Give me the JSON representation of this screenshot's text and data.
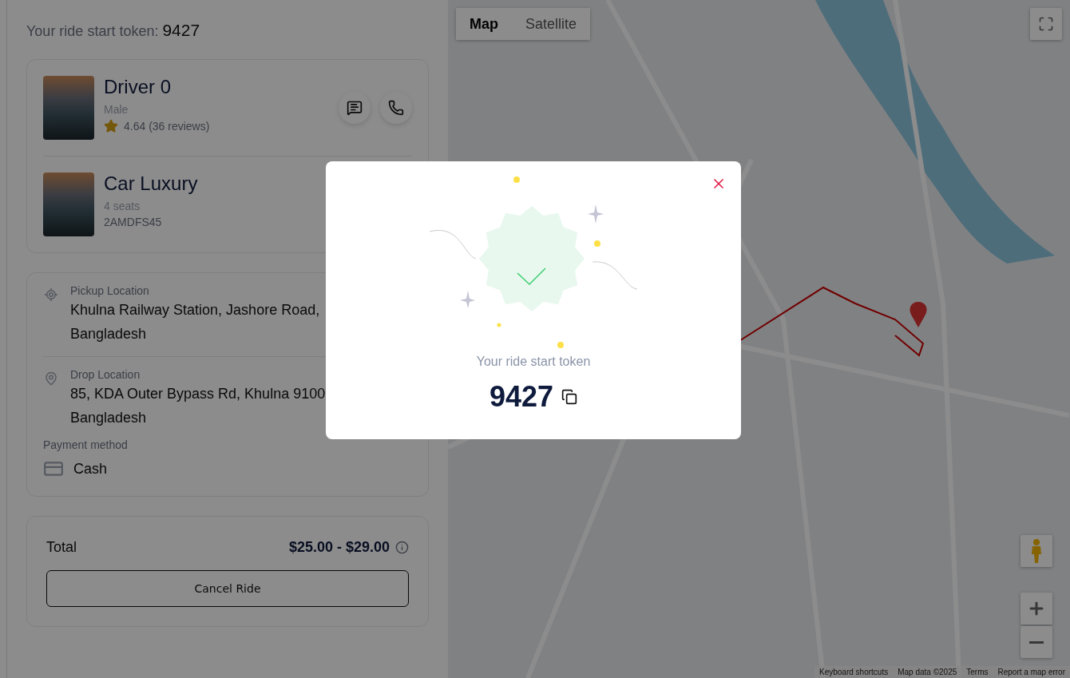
{
  "header": {
    "label": "Your ride start token:",
    "token": "9427"
  },
  "driver": {
    "name": "Driver 0",
    "gender": "Male",
    "rating": "4.64 (36 reviews)"
  },
  "vehicle": {
    "name": "Car Luxury",
    "seats": "4 seats",
    "plate": "2AMDFS45"
  },
  "route": [
    {
      "kind": "pickup",
      "label": "Pickup Location",
      "lines": [
        "Khulna Railway Station, Jashore Road,",
        "Bangladesh"
      ]
    },
    {
      "kind": "drop",
      "label": "Drop Location",
      "lines": [
        "85, KDA Outer Bypass Rd, Khulna 9100",
        "Bangladesh"
      ]
    }
  ],
  "payment": {
    "label": "Payment method",
    "method": "Cash"
  },
  "total": {
    "label": "Total",
    "amount": "$25.00 - $29.00"
  },
  "cancel_button": "Cancel Ride",
  "map": {
    "types": [
      {
        "label": "Map",
        "selected": true
      },
      {
        "label": "Satellite",
        "selected": false
      }
    ],
    "footer": [
      "Keyboard shortcuts",
      "Map data ©2025",
      "Terms",
      "Report a map error"
    ]
  },
  "modal": {
    "caption": "Your ride start token",
    "token": "9427"
  }
}
